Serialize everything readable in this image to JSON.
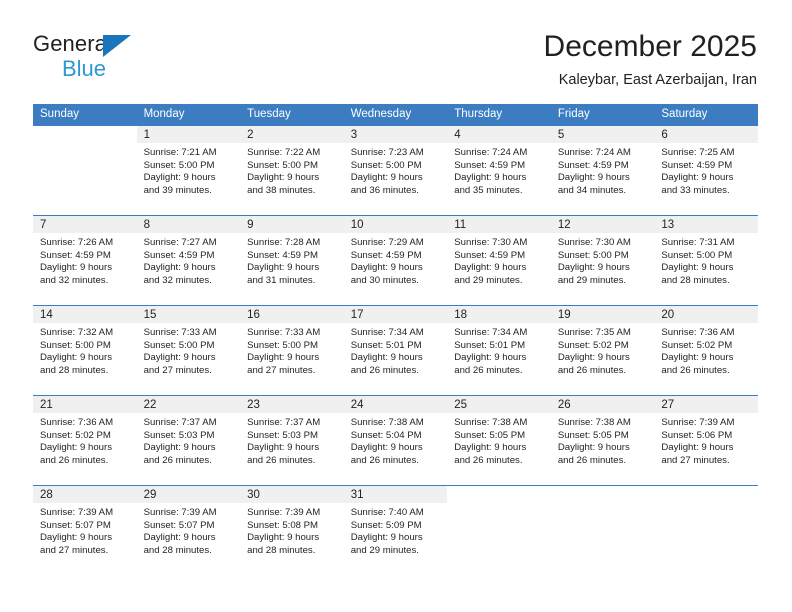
{
  "brand": {
    "name_top": "General",
    "name_bottom": "Blue",
    "triangle_color": "#1b75bb",
    "blue_text_color": "#2e97d4"
  },
  "header": {
    "title": "December 2025",
    "subtitle": "Kaleybar, East Azerbaijan, Iran"
  },
  "theme": {
    "header_bg": "#3b7dc0",
    "header_text": "#ffffff",
    "daynum_band_bg": "#f0f0f0",
    "text": "#231f20",
    "page_bg": "#ffffff"
  },
  "weekday_headers": [
    "Sunday",
    "Monday",
    "Tuesday",
    "Wednesday",
    "Thursday",
    "Friday",
    "Saturday"
  ],
  "weeks": [
    [
      {
        "day": "",
        "sunrise": "",
        "sunset": "",
        "daylight_line1": "",
        "daylight_line2": ""
      },
      {
        "day": "1",
        "sunrise": "Sunrise: 7:21 AM",
        "sunset": "Sunset: 5:00 PM",
        "daylight_line1": "Daylight: 9 hours",
        "daylight_line2": "and 39 minutes."
      },
      {
        "day": "2",
        "sunrise": "Sunrise: 7:22 AM",
        "sunset": "Sunset: 5:00 PM",
        "daylight_line1": "Daylight: 9 hours",
        "daylight_line2": "and 38 minutes."
      },
      {
        "day": "3",
        "sunrise": "Sunrise: 7:23 AM",
        "sunset": "Sunset: 5:00 PM",
        "daylight_line1": "Daylight: 9 hours",
        "daylight_line2": "and 36 minutes."
      },
      {
        "day": "4",
        "sunrise": "Sunrise: 7:24 AM",
        "sunset": "Sunset: 4:59 PM",
        "daylight_line1": "Daylight: 9 hours",
        "daylight_line2": "and 35 minutes."
      },
      {
        "day": "5",
        "sunrise": "Sunrise: 7:24 AM",
        "sunset": "Sunset: 4:59 PM",
        "daylight_line1": "Daylight: 9 hours",
        "daylight_line2": "and 34 minutes."
      },
      {
        "day": "6",
        "sunrise": "Sunrise: 7:25 AM",
        "sunset": "Sunset: 4:59 PM",
        "daylight_line1": "Daylight: 9 hours",
        "daylight_line2": "and 33 minutes."
      }
    ],
    [
      {
        "day": "7",
        "sunrise": "Sunrise: 7:26 AM",
        "sunset": "Sunset: 4:59 PM",
        "daylight_line1": "Daylight: 9 hours",
        "daylight_line2": "and 32 minutes."
      },
      {
        "day": "8",
        "sunrise": "Sunrise: 7:27 AM",
        "sunset": "Sunset: 4:59 PM",
        "daylight_line1": "Daylight: 9 hours",
        "daylight_line2": "and 32 minutes."
      },
      {
        "day": "9",
        "sunrise": "Sunrise: 7:28 AM",
        "sunset": "Sunset: 4:59 PM",
        "daylight_line1": "Daylight: 9 hours",
        "daylight_line2": "and 31 minutes."
      },
      {
        "day": "10",
        "sunrise": "Sunrise: 7:29 AM",
        "sunset": "Sunset: 4:59 PM",
        "daylight_line1": "Daylight: 9 hours",
        "daylight_line2": "and 30 minutes."
      },
      {
        "day": "11",
        "sunrise": "Sunrise: 7:30 AM",
        "sunset": "Sunset: 4:59 PM",
        "daylight_line1": "Daylight: 9 hours",
        "daylight_line2": "and 29 minutes."
      },
      {
        "day": "12",
        "sunrise": "Sunrise: 7:30 AM",
        "sunset": "Sunset: 5:00 PM",
        "daylight_line1": "Daylight: 9 hours",
        "daylight_line2": "and 29 minutes."
      },
      {
        "day": "13",
        "sunrise": "Sunrise: 7:31 AM",
        "sunset": "Sunset: 5:00 PM",
        "daylight_line1": "Daylight: 9 hours",
        "daylight_line2": "and 28 minutes."
      }
    ],
    [
      {
        "day": "14",
        "sunrise": "Sunrise: 7:32 AM",
        "sunset": "Sunset: 5:00 PM",
        "daylight_line1": "Daylight: 9 hours",
        "daylight_line2": "and 28 minutes."
      },
      {
        "day": "15",
        "sunrise": "Sunrise: 7:33 AM",
        "sunset": "Sunset: 5:00 PM",
        "daylight_line1": "Daylight: 9 hours",
        "daylight_line2": "and 27 minutes."
      },
      {
        "day": "16",
        "sunrise": "Sunrise: 7:33 AM",
        "sunset": "Sunset: 5:00 PM",
        "daylight_line1": "Daylight: 9 hours",
        "daylight_line2": "and 27 minutes."
      },
      {
        "day": "17",
        "sunrise": "Sunrise: 7:34 AM",
        "sunset": "Sunset: 5:01 PM",
        "daylight_line1": "Daylight: 9 hours",
        "daylight_line2": "and 26 minutes."
      },
      {
        "day": "18",
        "sunrise": "Sunrise: 7:34 AM",
        "sunset": "Sunset: 5:01 PM",
        "daylight_line1": "Daylight: 9 hours",
        "daylight_line2": "and 26 minutes."
      },
      {
        "day": "19",
        "sunrise": "Sunrise: 7:35 AM",
        "sunset": "Sunset: 5:02 PM",
        "daylight_line1": "Daylight: 9 hours",
        "daylight_line2": "and 26 minutes."
      },
      {
        "day": "20",
        "sunrise": "Sunrise: 7:36 AM",
        "sunset": "Sunset: 5:02 PM",
        "daylight_line1": "Daylight: 9 hours",
        "daylight_line2": "and 26 minutes."
      }
    ],
    [
      {
        "day": "21",
        "sunrise": "Sunrise: 7:36 AM",
        "sunset": "Sunset: 5:02 PM",
        "daylight_line1": "Daylight: 9 hours",
        "daylight_line2": "and 26 minutes."
      },
      {
        "day": "22",
        "sunrise": "Sunrise: 7:37 AM",
        "sunset": "Sunset: 5:03 PM",
        "daylight_line1": "Daylight: 9 hours",
        "daylight_line2": "and 26 minutes."
      },
      {
        "day": "23",
        "sunrise": "Sunrise: 7:37 AM",
        "sunset": "Sunset: 5:03 PM",
        "daylight_line1": "Daylight: 9 hours",
        "daylight_line2": "and 26 minutes."
      },
      {
        "day": "24",
        "sunrise": "Sunrise: 7:38 AM",
        "sunset": "Sunset: 5:04 PM",
        "daylight_line1": "Daylight: 9 hours",
        "daylight_line2": "and 26 minutes."
      },
      {
        "day": "25",
        "sunrise": "Sunrise: 7:38 AM",
        "sunset": "Sunset: 5:05 PM",
        "daylight_line1": "Daylight: 9 hours",
        "daylight_line2": "and 26 minutes."
      },
      {
        "day": "26",
        "sunrise": "Sunrise: 7:38 AM",
        "sunset": "Sunset: 5:05 PM",
        "daylight_line1": "Daylight: 9 hours",
        "daylight_line2": "and 26 minutes."
      },
      {
        "day": "27",
        "sunrise": "Sunrise: 7:39 AM",
        "sunset": "Sunset: 5:06 PM",
        "daylight_line1": "Daylight: 9 hours",
        "daylight_line2": "and 27 minutes."
      }
    ],
    [
      {
        "day": "28",
        "sunrise": "Sunrise: 7:39 AM",
        "sunset": "Sunset: 5:07 PM",
        "daylight_line1": "Daylight: 9 hours",
        "daylight_line2": "and 27 minutes."
      },
      {
        "day": "29",
        "sunrise": "Sunrise: 7:39 AM",
        "sunset": "Sunset: 5:07 PM",
        "daylight_line1": "Daylight: 9 hours",
        "daylight_line2": "and 28 minutes."
      },
      {
        "day": "30",
        "sunrise": "Sunrise: 7:39 AM",
        "sunset": "Sunset: 5:08 PM",
        "daylight_line1": "Daylight: 9 hours",
        "daylight_line2": "and 28 minutes."
      },
      {
        "day": "31",
        "sunrise": "Sunrise: 7:40 AM",
        "sunset": "Sunset: 5:09 PM",
        "daylight_line1": "Daylight: 9 hours",
        "daylight_line2": "and 29 minutes."
      },
      {
        "day": "",
        "sunrise": "",
        "sunset": "",
        "daylight_line1": "",
        "daylight_line2": ""
      },
      {
        "day": "",
        "sunrise": "",
        "sunset": "",
        "daylight_line1": "",
        "daylight_line2": ""
      },
      {
        "day": "",
        "sunrise": "",
        "sunset": "",
        "daylight_line1": "",
        "daylight_line2": ""
      }
    ]
  ]
}
